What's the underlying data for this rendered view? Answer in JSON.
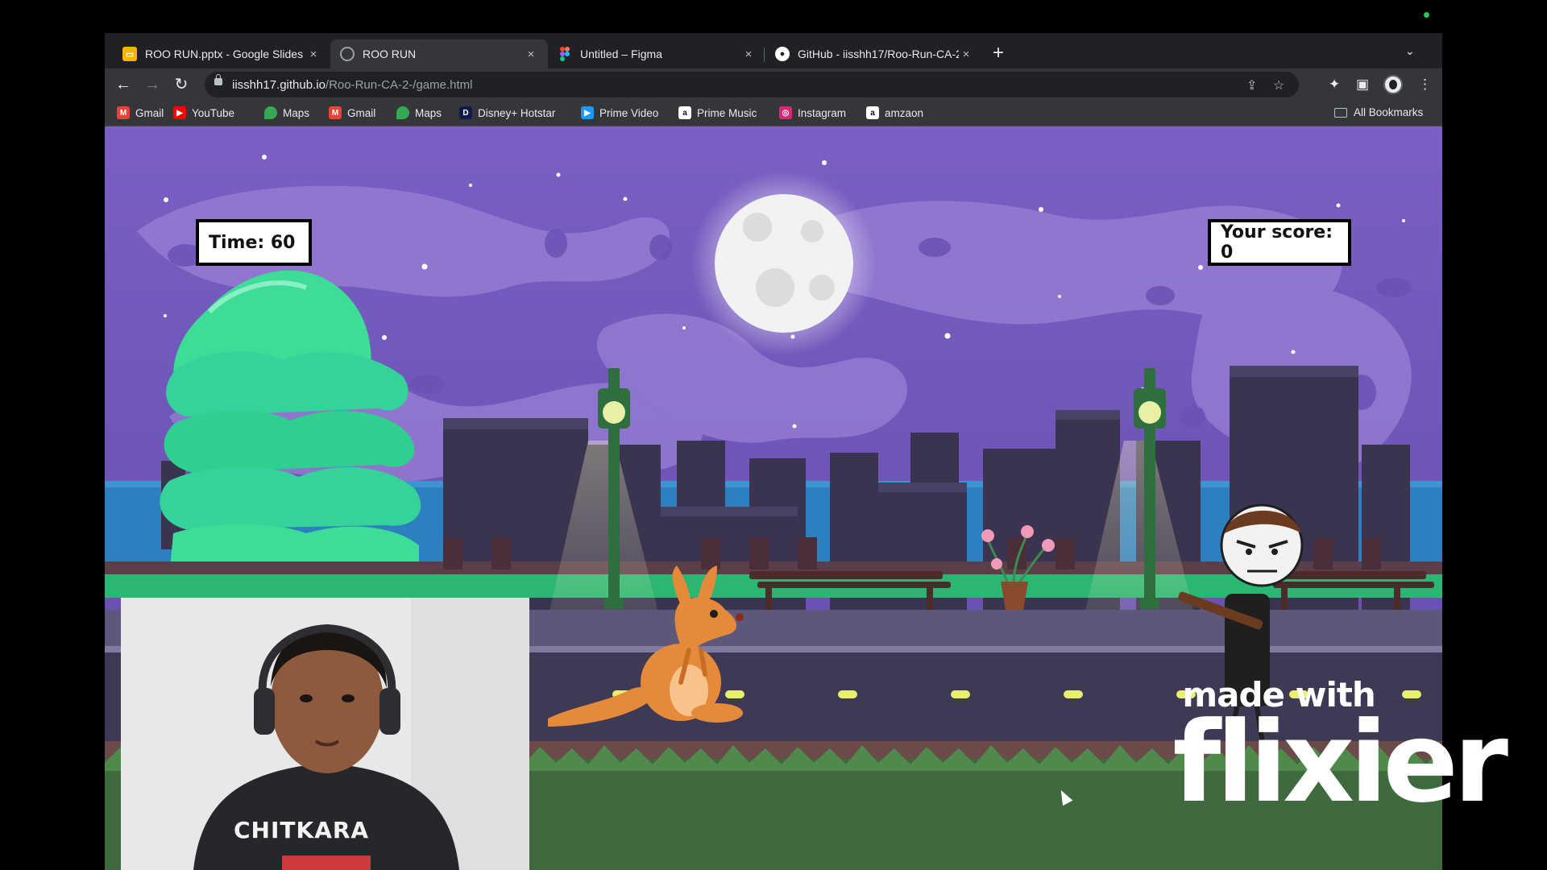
{
  "browser": {
    "tabs": [
      {
        "title": "ROO RUN.pptx - Google Slides",
        "icon": "google-slides-icon",
        "active": false
      },
      {
        "title": "ROO RUN",
        "icon": "globe-icon",
        "active": true
      },
      {
        "title": "Untitled – Figma",
        "icon": "figma-icon",
        "active": false
      },
      {
        "title": "GitHub - iisshh17/Roo-Run-CA-2",
        "icon": "github-icon",
        "active": false
      }
    ],
    "new_tab": "+",
    "tab_close": "×",
    "url_host": "iisshh17.github.io",
    "url_path": "/Roo-Run-CA-2-/game.html",
    "bookmarks": [
      {
        "label": "Gmail",
        "icon": "gmail-icon",
        "color": "#ea4335"
      },
      {
        "label": "YouTube",
        "icon": "youtube-icon",
        "color": "#ff0000"
      },
      {
        "label": "Maps",
        "icon": "maps-icon",
        "color": "#34a853"
      },
      {
        "label": "Gmail",
        "icon": "gmail-icon",
        "color": "#ea4335"
      },
      {
        "label": "Maps",
        "icon": "maps-icon",
        "color": "#34a853"
      },
      {
        "label": "Disney+ Hotstar",
        "icon": "hotstar-icon",
        "color": "#0f1a4a"
      },
      {
        "label": "Prime Video",
        "icon": "prime-video-icon",
        "color": "#1a98ff"
      },
      {
        "label": "Prime Music",
        "icon": "amazon-icon",
        "color": "#ffffff"
      },
      {
        "label": "Instagram",
        "icon": "instagram-icon",
        "color": "#d62976"
      },
      {
        "label": "amzaon",
        "icon": "amazon-icon",
        "color": "#ffffff"
      }
    ],
    "all_bookmarks": "All Bookmarks"
  },
  "game": {
    "time_label": "Time: 60",
    "score_label": "Your score: 0"
  },
  "webcam": {
    "hoodie_text": "CHITKARA"
  },
  "watermark": {
    "line1": "made with",
    "line2": "flixier"
  },
  "colors": {
    "sky": "#6e56b6",
    "tree": "#34d399",
    "water": "#2d7fbf",
    "road": "#3e3a55"
  }
}
